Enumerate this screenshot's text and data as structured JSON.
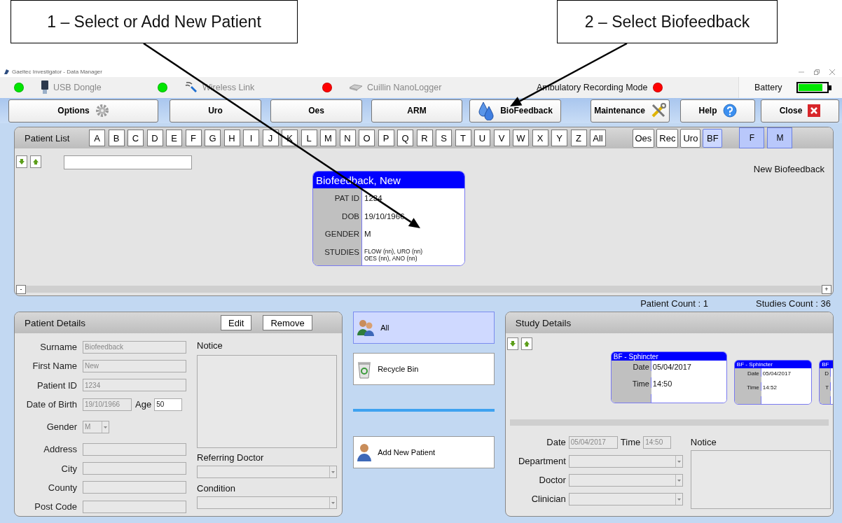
{
  "callouts": [
    {
      "text": "1 – Select or Add New Patient"
    },
    {
      "text": "2 – Select Biofeedback"
    }
  ],
  "window": {
    "title": "Gaeltec Investigator - Data Manager"
  },
  "status_bar": {
    "devices": [
      {
        "name": "USB Dongle",
        "kind": "usb",
        "color": "#00e600"
      },
      {
        "name": "Wireless Link",
        "kind": "wireless",
        "color": "#00e600"
      },
      {
        "name": "Cuillin NanoLogger",
        "kind": "logger",
        "color": "#ff0000"
      }
    ],
    "mode": {
      "label": "Ambulatory Recording Mode",
      "color": "#ff0000"
    },
    "battery": {
      "label": "Battery",
      "level": 0.85
    }
  },
  "nav_buttons": [
    {
      "label": "Options",
      "kind": "gear"
    },
    {
      "label": "Uro",
      "kind": "plain"
    },
    {
      "label": "Oes",
      "kind": "plain"
    },
    {
      "label": "ARM",
      "kind": "plain"
    },
    {
      "label": "BioFeedback",
      "kind": "drops"
    },
    {
      "label": "Maintenance",
      "kind": "tools"
    },
    {
      "label": "Help",
      "kind": "help"
    },
    {
      "label": "Close",
      "kind": "close"
    }
  ],
  "patient_list": {
    "title": "Patient List",
    "letters": [
      {
        "label": "A",
        "selected": false
      },
      {
        "label": "B",
        "selected": false
      },
      {
        "label": "C",
        "selected": false
      },
      {
        "label": "D",
        "selected": false
      },
      {
        "label": "E",
        "selected": false
      },
      {
        "label": "F",
        "selected": false
      },
      {
        "label": "G",
        "selected": false
      },
      {
        "label": "H",
        "selected": false
      },
      {
        "label": "I",
        "selected": false
      },
      {
        "label": "J",
        "selected": false
      },
      {
        "label": "K",
        "selected": false
      },
      {
        "label": "L",
        "selected": false
      },
      {
        "label": "M",
        "selected": false
      },
      {
        "label": "N",
        "selected": false
      },
      {
        "label": "O",
        "selected": false
      },
      {
        "label": "P",
        "selected": false
      },
      {
        "label": "Q",
        "selected": false
      },
      {
        "label": "R",
        "selected": false
      },
      {
        "label": "S",
        "selected": false
      },
      {
        "label": "T",
        "selected": false
      },
      {
        "label": "U",
        "selected": false
      },
      {
        "label": "V",
        "selected": false
      },
      {
        "label": "W",
        "selected": false
      },
      {
        "label": "X",
        "selected": false
      },
      {
        "label": "Y",
        "selected": false
      },
      {
        "label": "Z",
        "selected": false
      },
      {
        "label": "All",
        "selected": false
      }
    ],
    "filters": [
      {
        "label": "Oes",
        "selected": false
      },
      {
        "label": "Rec",
        "selected": false
      },
      {
        "label": "Uro",
        "selected": false
      },
      {
        "label": "BF",
        "selected": true
      }
    ],
    "genders": [
      {
        "label": "F",
        "selected": true
      },
      {
        "label": "M",
        "selected": true
      }
    ],
    "view_label": "New Biofeedback",
    "zoom_buttons": [
      "-",
      "+"
    ],
    "cards": [
      {
        "name": "Biofeedback, New",
        "fields": [
          {
            "label": "PAT ID",
            "kind": "large",
            "lines": [
              "1234"
            ]
          },
          {
            "label": "DOB",
            "kind": "large",
            "lines": [
              "19/10/1966"
            ]
          },
          {
            "label": "GENDER",
            "kind": "large",
            "lines": [
              "M"
            ]
          },
          {
            "label": "STUDIES",
            "kind": "small",
            "lines": [
              "FLOW (nn), URO (nn)",
              "OES (nn), ANO (nn)"
            ]
          }
        ]
      }
    ]
  },
  "counts": [
    "Patient Count : 1",
    "Studies Count : 36"
  ],
  "patient_details": {
    "title": "Patient Details",
    "buttons": [
      "Edit",
      "Remove"
    ],
    "fields": [
      {
        "label": "Surname",
        "kind": "text",
        "value": "Biofeedback"
      },
      {
        "label": "First Name",
        "kind": "text",
        "value": "New"
      },
      {
        "label": "Patient ID",
        "kind": "text",
        "value": "1234"
      },
      {
        "label": "Date of Birth",
        "kind": "date_age",
        "value": "19/10/1966",
        "age_label": "Age",
        "age": "50"
      },
      {
        "label": "Gender",
        "kind": "dropdown",
        "value": "M"
      },
      {
        "label": "Address",
        "kind": "text"
      },
      {
        "label": "City",
        "kind": "text"
      },
      {
        "label": "County",
        "kind": "text"
      },
      {
        "label": "Post Code",
        "kind": "text"
      }
    ],
    "notice_label": "Notice",
    "referring_label": "Referring Doctor",
    "condition_label": "Condition"
  },
  "actions": [
    {
      "label": "All",
      "kind": "people",
      "selected": true
    },
    {
      "label": "Recycle Bin",
      "kind": "bin",
      "selected": false
    },
    {
      "label": "Add New Patient",
      "kind": "person",
      "selected": false
    }
  ],
  "study_details": {
    "title": "Study Details",
    "cards": [
      {
        "kind": "large",
        "title": "BF - Sphincter",
        "date_label": "Date",
        "date": "05/04/2017",
        "time_label": "Time",
        "time": "14:50"
      },
      {
        "kind": "small",
        "title": "BF - Sphincter",
        "date_label": "Date",
        "date": "05/04/2017",
        "time_label": "Time",
        "time": "14:52"
      },
      {
        "kind": "cut",
        "title": "BF",
        "date_label": "D",
        "time_label": "T"
      }
    ],
    "date_label": "Date",
    "date": "05/04/2017",
    "time_label": "Time",
    "time": "14:50",
    "notice_label": "Notice",
    "fields": [
      {
        "label": "Department"
      },
      {
        "label": "Doctor"
      },
      {
        "label": "Clinician"
      }
    ]
  }
}
